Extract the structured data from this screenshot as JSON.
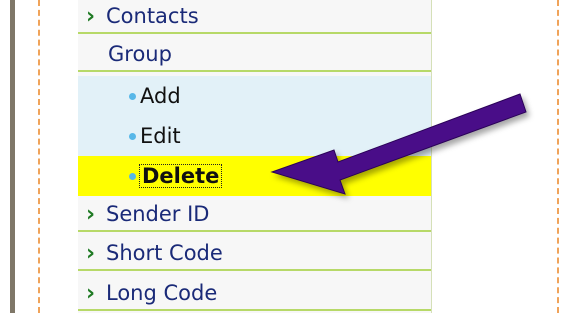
{
  "menu": {
    "contacts": "Contacts",
    "group": "Group",
    "group_items": [
      "Add",
      "Edit",
      "Delete"
    ],
    "sender_id": "Sender ID",
    "short_code": "Short Code",
    "long_code": "Long Code"
  },
  "icons": {
    "chevron": "›",
    "arrow": "purple-pointer-arrow"
  },
  "colors": {
    "highlight": "#ffff00",
    "submenu_bg": "#e2f1f8",
    "arrow": "#4a0f88"
  }
}
